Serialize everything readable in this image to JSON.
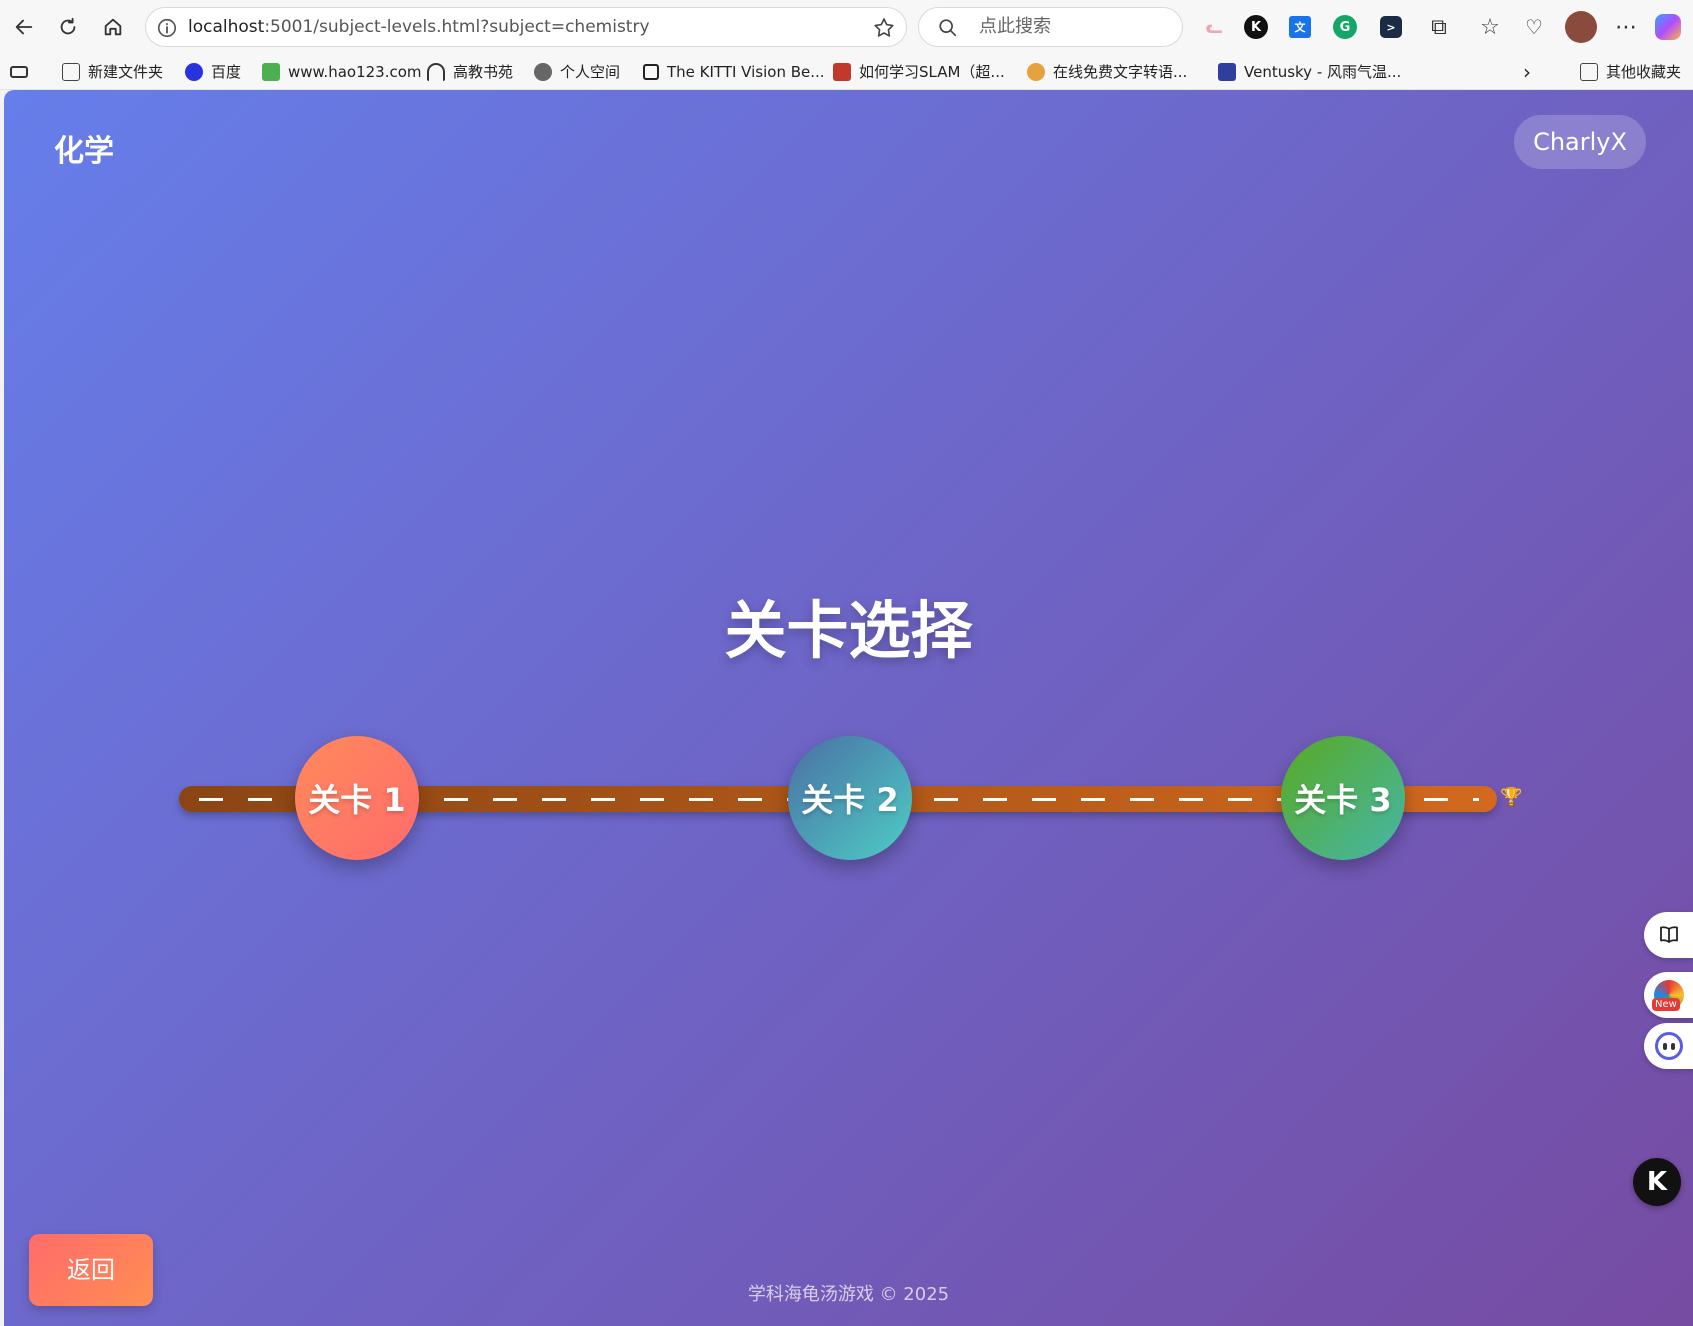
{
  "browser": {
    "url_host": "localhost",
    "url_rest": ":5001/subject-levels.html?subject=chemistry",
    "search_placeholder": "点此搜索"
  },
  "bookmarks": [
    {
      "label": "新建文件夹",
      "icon": "folder-icon"
    },
    {
      "label": "百度",
      "icon": "baidu-icon"
    },
    {
      "label": "www.hao123.com",
      "icon": "hao123-icon"
    },
    {
      "label": "高教书苑",
      "icon": "headphones-icon"
    },
    {
      "label": "个人空间",
      "icon": "globe-icon"
    },
    {
      "label": "The KITTI Vision Be...",
      "icon": "page-icon"
    },
    {
      "label": "如何学习SLAM（超...",
      "icon": "zhihu-icon"
    },
    {
      "label": "在线免费文字转语...",
      "icon": "tts-icon"
    },
    {
      "label": "Ventusky - 风雨气温...",
      "icon": "ventusky-icon"
    },
    {
      "label": "其他收藏夹",
      "icon": "folder-icon"
    }
  ],
  "page": {
    "subject": "化学",
    "user": "CharlyX",
    "title": "关卡选择",
    "levels": [
      {
        "label": "关卡 1",
        "color": "#ff6b6b"
      },
      {
        "label": "关卡 2",
        "color": "#4ecdc4"
      },
      {
        "label": "关卡 3",
        "color": "#56ab2f"
      }
    ],
    "trophy": "🏆",
    "back_label": "返回",
    "footer": "学科海龟汤游戏 © 2025",
    "side_new_badge": "New",
    "k_button": "K"
  },
  "colors": {
    "bg_start": "#667eea",
    "bg_end": "#764ba2",
    "road_start": "#8B4513",
    "road_end": "#D2691E"
  }
}
